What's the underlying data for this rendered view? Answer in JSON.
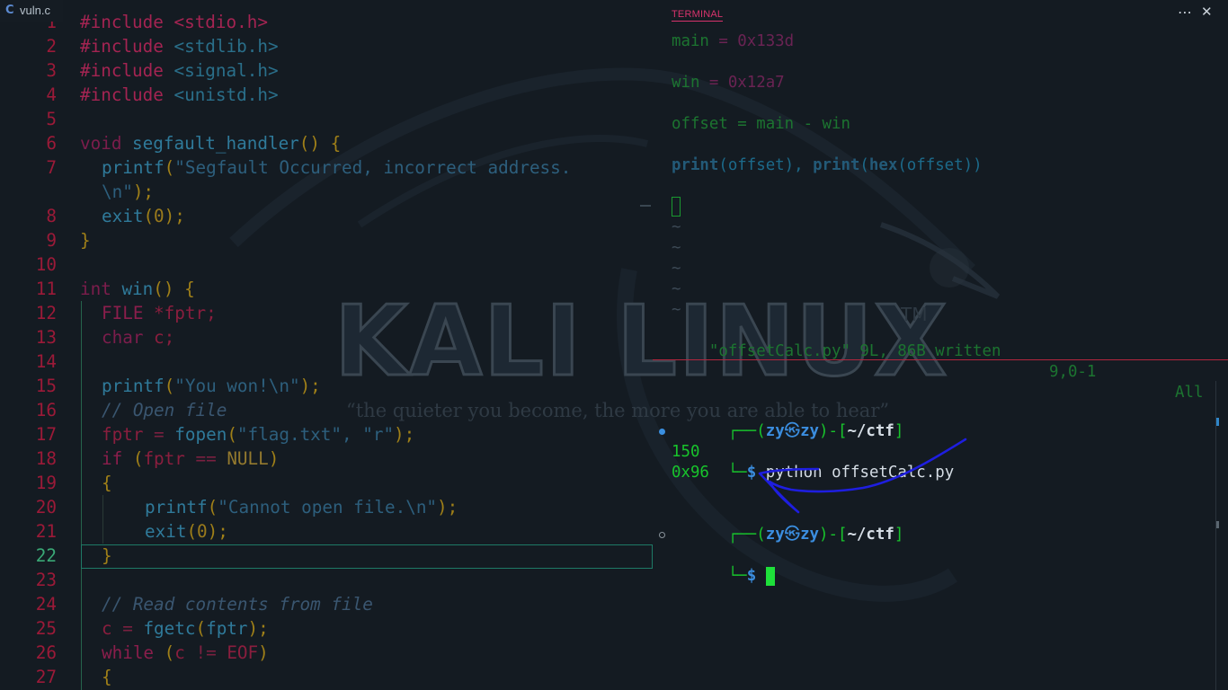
{
  "watermark": {
    "title": "KALI LINUX",
    "trademark": "TM",
    "tagline": "“the quieter you become, the more you are able to hear”"
  },
  "editor": {
    "tab_label": "vuln.c",
    "tab_icon_letter": "C",
    "line_numbers": [
      "1",
      "2",
      "3",
      "4",
      "5",
      "6",
      "7",
      "",
      "8",
      "9",
      "10",
      "11",
      "12",
      "13",
      "14",
      "15",
      "16",
      "17",
      "18",
      "19",
      "20",
      "21",
      "22",
      "23",
      "24",
      "25",
      "26",
      "27"
    ],
    "active_line": "22",
    "code": {
      "l1": "#include <stdio.h>",
      "l2a": "#include",
      "l2b": "<stdlib.h>",
      "l3a": "#include",
      "l3b": "<signal.h>",
      "l4a": "#include",
      "l4b": "<unistd.h>",
      "l6a": "void",
      "l6b": "segfault_handler",
      "l6c": "()",
      "l6d": "{",
      "l7a": "printf",
      "l7b": "(",
      "l7c": "\"Segfault Occurred, incorrect address.",
      "l7d": "\\n\"",
      "l7e": ");",
      "l8a": "exit",
      "l8b": "(",
      "l8c": "0",
      "l8d": ");",
      "l9": "}",
      "l11a": "int",
      "l11b": "win",
      "l11c": "()",
      "l11d": "{",
      "l12a": "FILE",
      "l12b": "*fptr;",
      "l13a": "char",
      "l13b": "c;",
      "l15a": "printf",
      "l15b": "(",
      "l15c": "\"You won!\\n\"",
      "l15d": ");",
      "l16": "// Open file",
      "l17a": "fptr",
      "l17b": "=",
      "l17c": "fopen",
      "l17d": "(",
      "l17e": "\"flag.txt\", \"r\"",
      "l17f": ");",
      "l18a": "if",
      "l18b": "(",
      "l18c": "fptr",
      "l18d": "==",
      "l18e": "NULL",
      "l18f": ")",
      "l19": "{",
      "l20a": "printf",
      "l20b": "(",
      "l20c": "\"Cannot open file.\\n\"",
      "l20d": ");",
      "l21a": "exit",
      "l21b": "(",
      "l21c": "0",
      "l21d": ");",
      "l22": "}",
      "l24": "// Read contents from file",
      "l25a": "c",
      "l25b": "=",
      "l25c": "fgetc",
      "l25d": "(",
      "l25e": "fptr",
      "l25f": ");",
      "l26a": "while",
      "l26b": "(",
      "l26c": "c",
      "l26d": "!=",
      "l26e": "EOF",
      "l26f": ")",
      "l27": "{"
    }
  },
  "terminal": {
    "tab_label": "TERMINAL",
    "more_icon": "⋯",
    "close_icon": "✕",
    "vim": {
      "l1a": "main",
      "l1b": " = 0x133d",
      "l2a": "win",
      "l2b": " = 0x12a7",
      "l3": "offset = main - win",
      "l4a": "print",
      "l4b": "(offset), ",
      "l4c": "print",
      "l4d": "(",
      "l4e": "hex",
      "l4f": "(offset))",
      "tilde": "~",
      "status_file": "\"offsetCalc.py\" 9L, 86B written",
      "status_pos": "9,0-1",
      "status_all": "All"
    },
    "shell": {
      "box_top": "┌──(",
      "user": "zy",
      "at_icon": "㉿",
      "host": "zy",
      "sep": ")-[",
      "path": "~/ctf",
      "close_bracket": "]",
      "box_bottom": "└─",
      "dollar": "$",
      "command_name": "python",
      "command_arg": "offsetCalc.py",
      "output_1": "150",
      "output_2": "0x96"
    }
  },
  "colors": {
    "annotation_arrow": "#1e1ee0",
    "cursor": "#1ee03a"
  }
}
